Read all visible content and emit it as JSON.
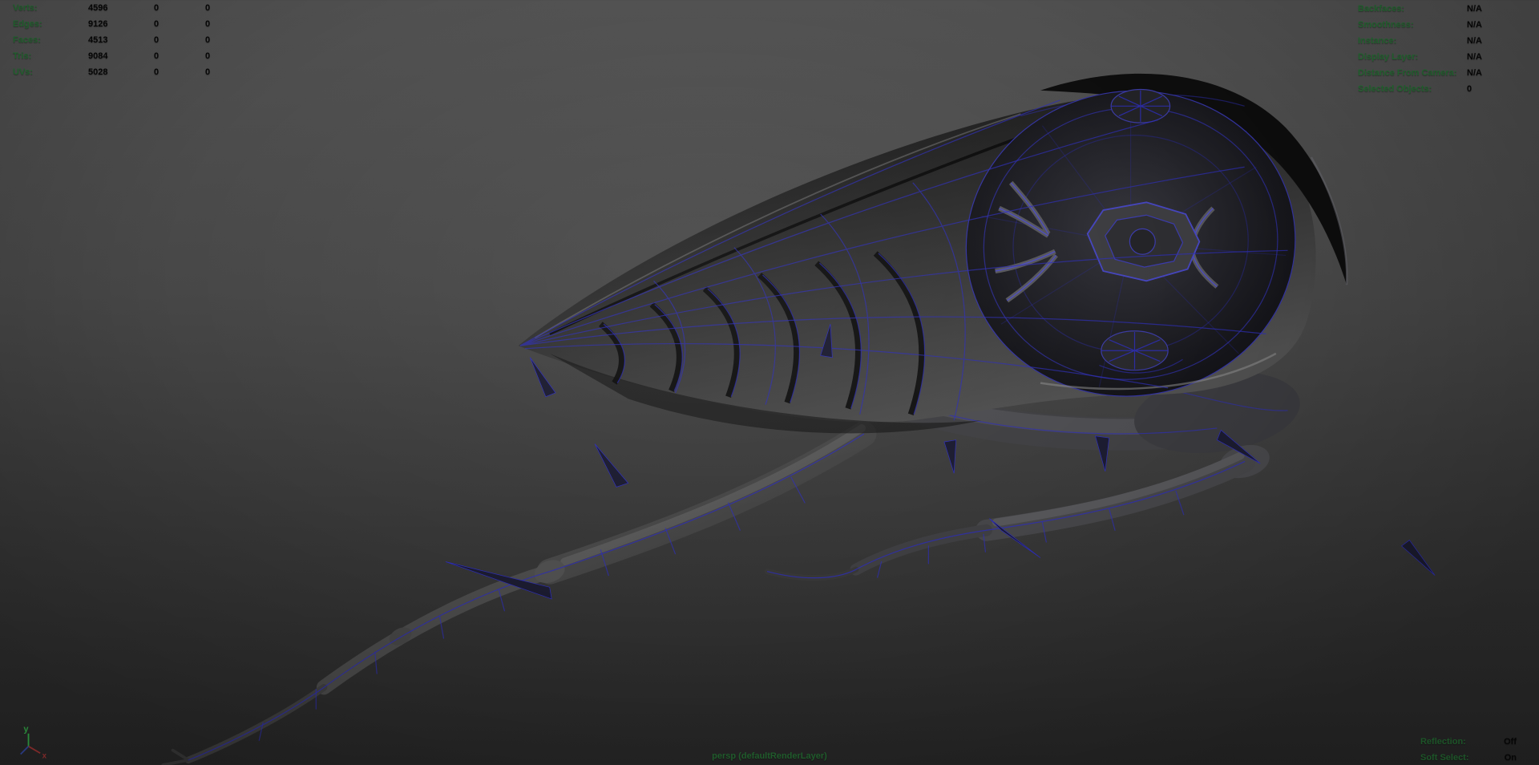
{
  "viewport": {
    "camera_label": "persp (defaultRenderLayer)"
  },
  "hud": {
    "poly_count": [
      {
        "label": "Verts:",
        "count": "4596",
        "col2": "0",
        "col3": "0"
      },
      {
        "label": "Edges:",
        "count": "9126",
        "col2": "0",
        "col3": "0"
      },
      {
        "label": "Faces:",
        "count": "4513",
        "col2": "0",
        "col3": "0"
      },
      {
        "label": "Tris:",
        "count": "9084",
        "col2": "0",
        "col3": "0"
      },
      {
        "label": "UVs:",
        "count": "5028",
        "col2": "0",
        "col3": "0"
      }
    ],
    "object_info": [
      {
        "label": "Backfaces:",
        "value": "N/A"
      },
      {
        "label": "Smoothness:",
        "value": "N/A"
      },
      {
        "label": "Instance:",
        "value": "N/A"
      },
      {
        "label": "Display Layer:",
        "value": "N/A"
      },
      {
        "label": "Distance From Camera:",
        "value": "N/A"
      },
      {
        "label": "Selected Objects:",
        "value": "0"
      }
    ],
    "toggles": [
      {
        "label": "Reflection:",
        "value": "Off"
      },
      {
        "label": "Soft Select:",
        "value": "On"
      }
    ]
  },
  "axis": {
    "y": "y",
    "x": "x"
  },
  "colors": {
    "hud-label": "#256b33",
    "hud-value": "#070707",
    "bg-top": "#515151",
    "bg-bottom": "#272727",
    "wireframe": "#2d2db4",
    "wireframe-bright": "#4a4ad0",
    "axis-y": "#35b04a",
    "axis-x": "#a03434",
    "axis-z": "#3548a0"
  }
}
